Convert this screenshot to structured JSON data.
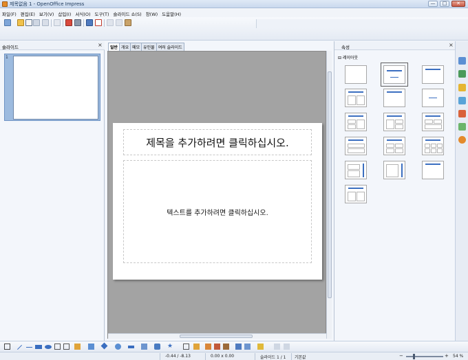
{
  "window": {
    "title": "제목없음 1 - OpenOffice Impress",
    "minimize": "—",
    "maximize": "□",
    "close": "✕"
  },
  "menu": [
    "파일(F)",
    "편집(E)",
    "보기(V)",
    "삽입(I)",
    "서식(O)",
    "도구(T)",
    "슬라이드 쇼(S)",
    "창(W)",
    "도움말(H)"
  ],
  "slides_pane": {
    "title": "슬라이드",
    "close": "×",
    "slides": [
      {
        "number": "1"
      }
    ]
  },
  "view_tabs": [
    "일반",
    "개요",
    "메모",
    "유인물",
    "여러 슬라이드"
  ],
  "slide": {
    "title_placeholder": "제목을 추가하려면 클릭하십시오.",
    "body_placeholder": "텍스트를 추가하려면 클릭하십시오."
  },
  "properties": {
    "title": "속성",
    "close": "×",
    "section_toggle": "⊟",
    "layout_section": "레이아웃"
  },
  "statusbar": {
    "position": "-0.44 / -8.13",
    "size": "0.00 x 0.00",
    "slide": "슬라이드 1 / 1",
    "master": "기본값",
    "zoom_minus": "−",
    "zoom_plus": "+",
    "zoom": "54 %"
  },
  "colors": {
    "accent": "#3a6ec0",
    "canvas": "#a3a3a3"
  }
}
